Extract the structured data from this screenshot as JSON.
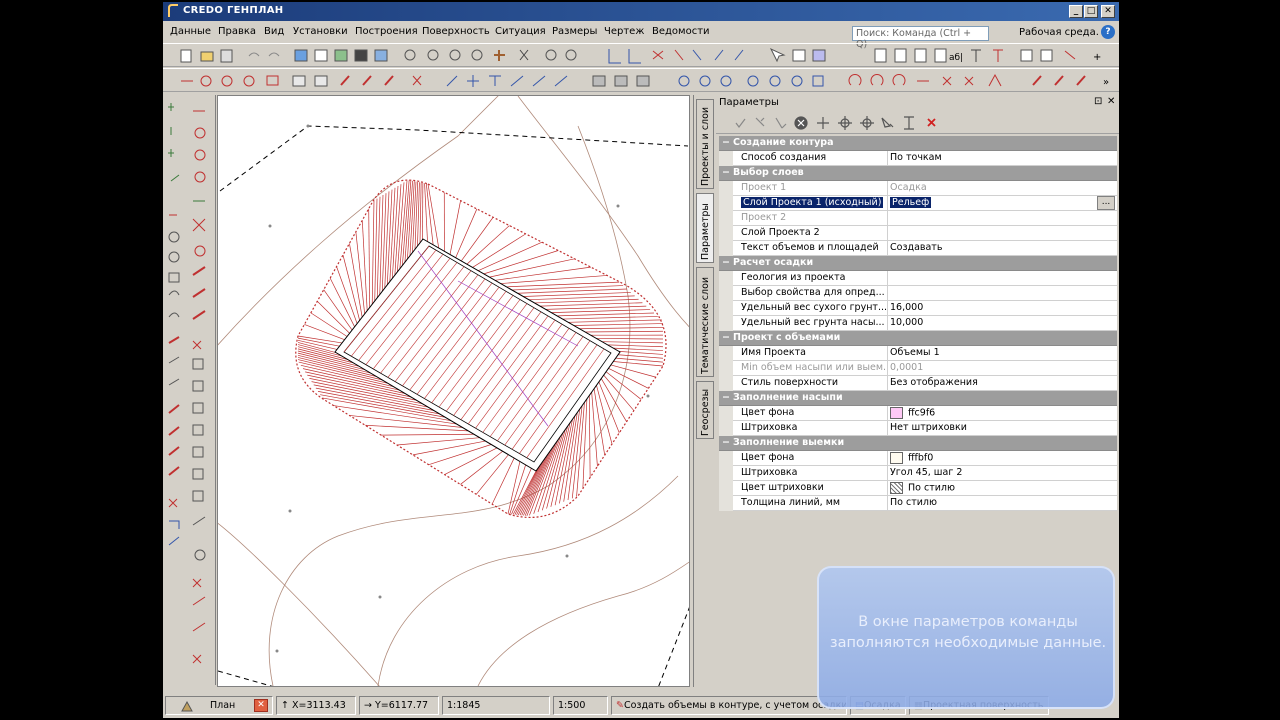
{
  "window": {
    "title": "CREDO ГЕНПЛАН",
    "buttons": [
      "_",
      "□",
      "✕"
    ]
  },
  "menu": {
    "items": [
      "Данные",
      "Правка",
      "Вид",
      "Установки",
      "Построения",
      "Поверхность",
      "Ситуация",
      "Размеры",
      "Чертеж",
      "Ведомости"
    ],
    "search_placeholder": "Поиск: Команда (Ctrl + Q)",
    "workspace": "Рабочая среда.",
    "help": "?"
  },
  "side_tabs": [
    "Проекты и слои",
    "Параметры",
    "Тематические слои",
    "Геосрезы"
  ],
  "params": {
    "header": "Параметры",
    "pin": "⊡",
    "close": "✕",
    "rows": [
      {
        "type": "cat",
        "name": "Создание контура"
      },
      {
        "type": "row",
        "name": "Способ создания",
        "value": "По точкам"
      },
      {
        "type": "cat",
        "name": "Выбор слоев"
      },
      {
        "type": "row",
        "name": "Проект 1",
        "value": "Осадка",
        "disabled": true
      },
      {
        "type": "row",
        "name": "Слой Проекта 1 (исходный)",
        "value": "Рельеф",
        "selected": true
      },
      {
        "type": "row",
        "name": "Проект 2",
        "value": "",
        "disabled": true
      },
      {
        "type": "row",
        "name": "Слой Проекта 2",
        "value": ""
      },
      {
        "type": "row",
        "name": "Текст объемов и площадей",
        "value": "Создавать"
      },
      {
        "type": "cat",
        "name": "Расчет осадки"
      },
      {
        "type": "row",
        "name": "Геология из проекта",
        "value": ""
      },
      {
        "type": "row",
        "name": "Выбор свойства для опред...",
        "value": ""
      },
      {
        "type": "row",
        "name": "Удельный вес сухого грунт...",
        "value": "16,000"
      },
      {
        "type": "row",
        "name": "Удельный вес грунта насы...",
        "value": "10,000"
      },
      {
        "type": "cat",
        "name": "Проект с объемами"
      },
      {
        "type": "row",
        "name": "Имя Проекта",
        "value": "Объемы 1"
      },
      {
        "type": "row",
        "name": "Min объем насыпи или выем...",
        "value": "0,0001",
        "disabled": true
      },
      {
        "type": "row",
        "name": "Стиль поверхности",
        "value": "Без отображения"
      },
      {
        "type": "cat",
        "name": "Заполнение насыпи"
      },
      {
        "type": "row",
        "name": "Цвет фона",
        "value": "ffc9f6",
        "swatch": "#ffc9f6"
      },
      {
        "type": "row",
        "name": "Штриховка",
        "value": "Нет штриховки"
      },
      {
        "type": "cat",
        "name": "Заполнение выемки"
      },
      {
        "type": "row",
        "name": "Цвет фона",
        "value": "fffbf0",
        "swatch": "#fffbf0"
      },
      {
        "type": "row",
        "name": "Штриховка",
        "value": "Угол 45, шаг 2"
      },
      {
        "type": "row",
        "name": "Цвет штриховки",
        "value": "По стилю",
        "swatch": "hatch"
      },
      {
        "type": "row",
        "name": "Толщина линий, мм",
        "value": "По стилю"
      }
    ],
    "ellipsis": "..."
  },
  "status": {
    "view": "План",
    "x": "X=3113.43",
    "y": "Y=6117.77",
    "scale1": "1:1845",
    "scale2": "1:500",
    "hint": "Создать объемы в контуре, с учетом осадки",
    "project": "Осадка",
    "layer": "Проектная поверхность"
  },
  "tooltip": {
    "text": "В окне параметров команды заполняются необходимые данные."
  },
  "colors": {
    "title_bar": "#2a4f8f",
    "category_row": "#9d9d9d",
    "selection": "#0a246a",
    "embankment": "#ffc9f6",
    "cut": "#fffbf0",
    "hatch_red": "#c0282a"
  }
}
